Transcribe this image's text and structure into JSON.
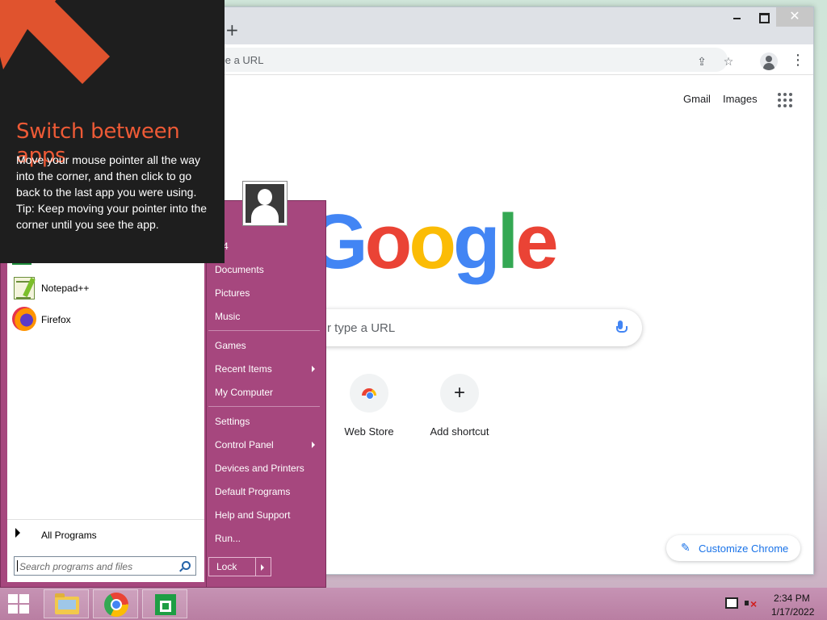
{
  "browser": {
    "new_tab_symbol": "+",
    "window_controls": {
      "minimize": "",
      "maximize": "",
      "close": "✕"
    },
    "omnibox_placeholder": "ype a URL",
    "header_links": {
      "gmail": "Gmail",
      "images": "Images"
    },
    "google_logo": [
      "G",
      "o",
      "o",
      "g",
      "l",
      "e"
    ],
    "search_placeholder": "r type a URL",
    "shortcuts": [
      {
        "label": "Web Store",
        "icon": "chrome-web-store-icon"
      },
      {
        "label": "Add shortcut",
        "icon": "plus-icon",
        "symbol": "+"
      }
    ],
    "customize_button": "Customize Chrome",
    "colors": {
      "blue": "#4285f4",
      "red": "#ea4335",
      "yellow": "#fbbc05",
      "green": "#34a853",
      "link": "#1a73e8"
    }
  },
  "tip": {
    "title": "Switch between apps",
    "body_line1": "Move your mouse pointer all the way into the corner, and then click to go back to the last app you were using.",
    "body_line2": "Tip: Keep moving your pointer into the corner until you see the app.",
    "accent_color": "#ee5a36"
  },
  "start_menu": {
    "programs": [
      {
        "label": "Notepad++",
        "icon": "notepad-plus-plus-icon"
      },
      {
        "label": "Firefox",
        "icon": "firefox-icon"
      }
    ],
    "all_programs": "All Programs",
    "search_placeholder": "Search programs and files",
    "right_items": {
      "user": "M4",
      "documents": "Documents",
      "pictures": "Pictures",
      "music": "Music",
      "games": "Games",
      "recent_items": "Recent Items",
      "my_computer": "My Computer",
      "settings": "Settings",
      "control_panel": "Control Panel",
      "devices": "Devices and Printers",
      "default_programs": "Default Programs",
      "help": "Help and Support",
      "run": "Run..."
    },
    "lock_button": "Lock",
    "accent_color": "#a6477e"
  },
  "taskbar": {
    "pinned": [
      "file-explorer-icon",
      "chrome-icon",
      "store-icon"
    ],
    "clock": {
      "time": "2:34 PM",
      "date": "1/17/2022"
    }
  }
}
